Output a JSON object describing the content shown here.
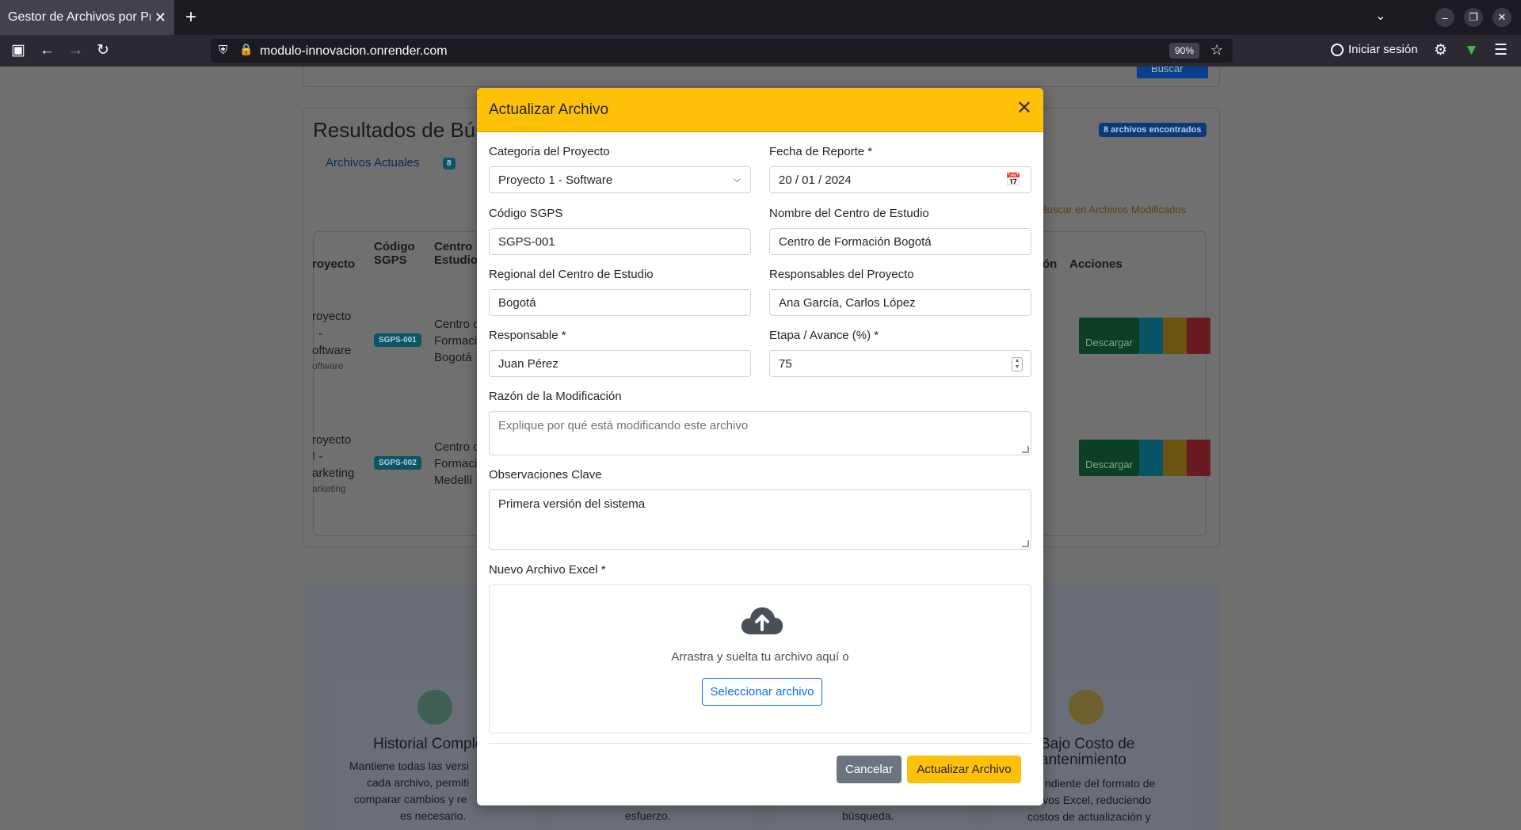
{
  "browser": {
    "tab_title": "Gestor de Archivos por Proyecto",
    "tab_close": "✕",
    "new_tab": "+",
    "url": "modulo-innovacion.onrender.com",
    "zoom": "90%",
    "sign_in": "Iniciar sesión"
  },
  "background": {
    "results_title": "Resultados de Bús",
    "current_files_tab": "Archivos Actuales",
    "current_files_count": "8",
    "files_found_badge": "8 archivos encontrados",
    "search_modified_label": "Buscar en Archivos Modificados",
    "search_button": "Buscar",
    "columns": [
      "royecto",
      "Código SGPS",
      "Centro Estudio",
      "ón",
      "Acciones"
    ],
    "rows": [
      {
        "project_lines": [
          "royecto",
          "-",
          "oftware"
        ],
        "category": "oftware",
        "code": "SGPS-001",
        "center_lines": [
          "Centro c",
          "Formaci",
          "Bogotá"
        ],
        "download": "Descargar"
      },
      {
        "project_lines": [
          "royecto",
          "! -",
          "arketing"
        ],
        "category": "arketing",
        "code": "SGPS-002",
        "center_lines": [
          "Centro c",
          "Formaci",
          "Medellí"
        ],
        "download": "Descargar"
      }
    ],
    "features": [
      {
        "title": "Historial Comple",
        "text_lines": [
          "Mantiene todas las versi",
          "cada archivo, permiti",
          "comparar cambios y re",
          "es necesario."
        ]
      },
      {
        "title": "",
        "text_lines": [
          "esfuerzo."
        ]
      },
      {
        "title": "",
        "text_lines": [
          "búsqueda."
        ]
      },
      {
        "title_lines": [
          "Bajo Costo de",
          "antenimiento"
        ],
        "text_lines": [
          "ndiente del formato de",
          "ivos Excel, reduciendo",
          "costos de actualización y"
        ]
      }
    ]
  },
  "modal": {
    "title": "Actualizar Archivo",
    "close_icon": "✕",
    "category_label": "Categoria del Proyecto",
    "category_value": "Proyecto 1 - Software",
    "report_date_label": "Fecha de Reporte *",
    "report_date_value": "20 / 01 / 2024",
    "sgps_label": "Código SGPS",
    "sgps_value": "SGPS-001",
    "center_name_label": "Nombre del Centro de Estudio",
    "center_name_value": "Centro de Formación Bogotá",
    "regional_label": "Regional del Centro de Estudio",
    "regional_value": "Bogotá",
    "project_leads_label": "Responsables del Proyecto",
    "project_leads_value": "Ana García, Carlos López",
    "responsible_label": "Responsable *",
    "responsible_value": "Juan Pérez",
    "progress_label": "Etapa / Avance (%) *",
    "progress_value": "75",
    "reason_label": "Razón de la Modificación",
    "reason_placeholder": "Explique por qué está modificando este archivo",
    "observations_label": "Observaciones Clave",
    "observations_value": "Primera versión del sistema",
    "new_file_label": "Nuevo Archivo Excel *",
    "dropzone_text": "Arrastra y suelta tu archivo aquí o",
    "select_file_button": "Seleccionar archivo",
    "cancel_button": "Cancelar",
    "update_button": "Actualizar Archivo"
  },
  "colors": {
    "header_accent": "#ffc107",
    "primary": "#0d6efd",
    "secondary": "#6c757d",
    "download_green": "#198754",
    "view_blue": "#0dcaf0",
    "delete_red": "#dc3545"
  }
}
